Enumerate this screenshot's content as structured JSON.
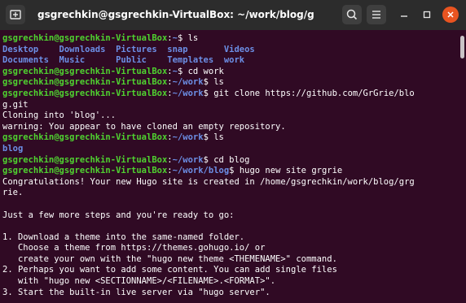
{
  "window": {
    "title": "gsgrechkin@gsgrechkin-VirtualBox: ~/work/blog/grgrie/public"
  },
  "colors": {
    "terminal_bg": "#300a24",
    "titlebar_bg": "#2c2c2c",
    "prompt_user": "#4fd130",
    "prompt_path": "#6c8fe6",
    "close_button": "#e95420"
  },
  "icons": {
    "new_tab": "new-tab-icon",
    "search": "search-icon",
    "menu": "hamburger-menu-icon",
    "minimize": "minimize-icon",
    "maximize": "maximize-icon",
    "close": "close-icon"
  },
  "terminal": {
    "lines": [
      {
        "user": "gsgrechkin@gsgrechkin-VirtualBox",
        "sep": ":",
        "path": "~",
        "cmd": "$ ls"
      },
      {
        "text": "Desktop    Downloads  Pictures  snap       Videos",
        "dir": true
      },
      {
        "text": "Documents  Music      Public    Templates  work",
        "dir": true
      },
      {
        "user": "gsgrechkin@gsgrechkin-VirtualBox",
        "sep": ":",
        "path": "~",
        "cmd": "$ cd work"
      },
      {
        "user": "gsgrechkin@gsgrechkin-VirtualBox",
        "sep": ":",
        "path": "~/work",
        "cmd": "$ ls"
      },
      {
        "user": "gsgrechkin@gsgrechkin-VirtualBox",
        "sep": ":",
        "path": "~/work",
        "cmd": "$ git clone https://github.com/GrGrie/blo"
      },
      {
        "text": "g.git"
      },
      {
        "text": "Cloning into 'blog'..."
      },
      {
        "text": "warning: You appear to have cloned an empty repository."
      },
      {
        "user": "gsgrechkin@gsgrechkin-VirtualBox",
        "sep": ":",
        "path": "~/work",
        "cmd": "$ ls"
      },
      {
        "text": "blog",
        "dir": true
      },
      {
        "user": "gsgrechkin@gsgrechkin-VirtualBox",
        "sep": ":",
        "path": "~/work",
        "cmd": "$ cd blog"
      },
      {
        "user": "gsgrechkin@gsgrechkin-VirtualBox",
        "sep": ":",
        "path": "~/work/blog",
        "cmd": "$ hugo new site grgrie"
      },
      {
        "text": "Congratulations! Your new Hugo site is created in /home/gsgrechkin/work/blog/grg"
      },
      {
        "text": "rie."
      },
      {
        "text": ""
      },
      {
        "text": "Just a few more steps and you're ready to go:"
      },
      {
        "text": ""
      },
      {
        "text": "1. Download a theme into the same-named folder."
      },
      {
        "text": "   Choose a theme from https://themes.gohugo.io/ or"
      },
      {
        "text": "   create your own with the \"hugo new theme <THEMENAME>\" command."
      },
      {
        "text": "2. Perhaps you want to add some content. You can add single files"
      },
      {
        "text": "   with \"hugo new <SECTIONNAME>/<FILENAME>.<FORMAT>\"."
      },
      {
        "text": "3. Start the built-in live server via \"hugo server\"."
      }
    ]
  }
}
